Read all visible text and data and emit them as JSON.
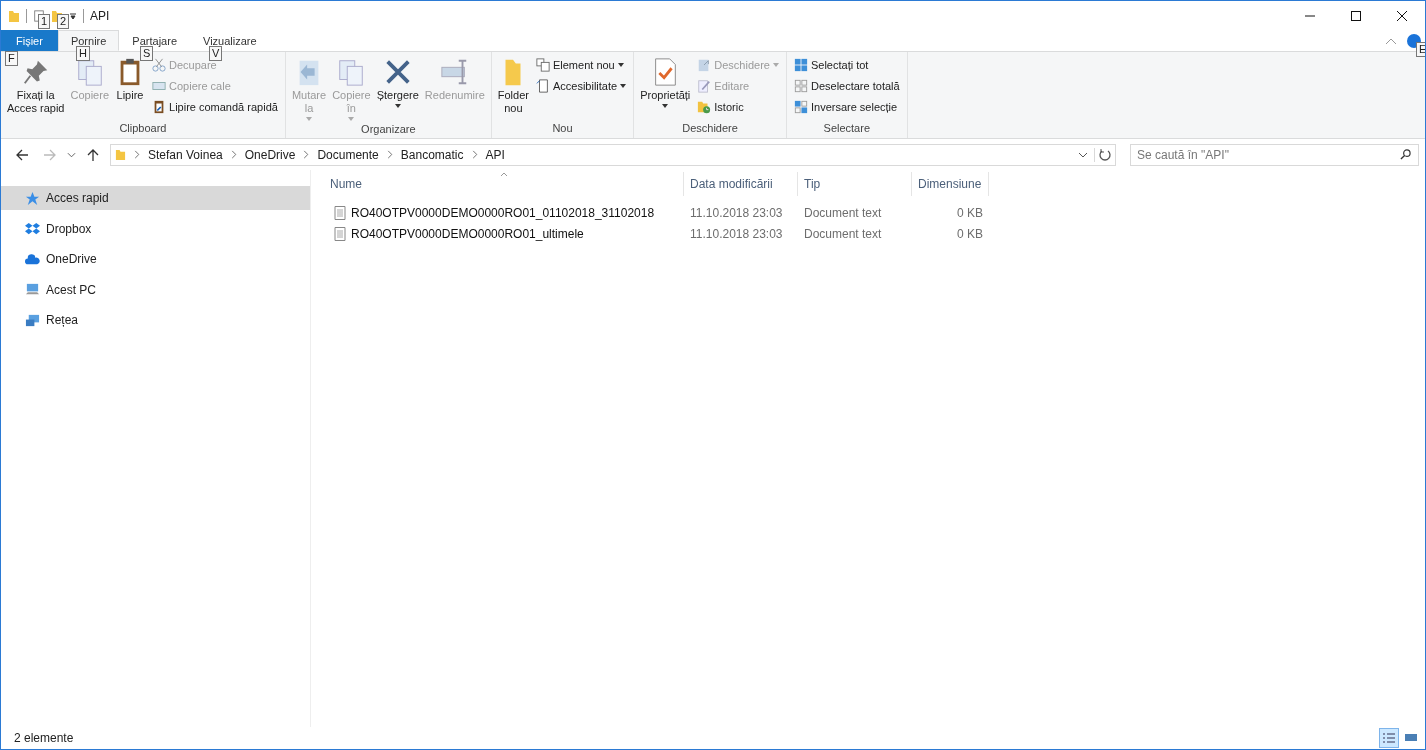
{
  "window": {
    "title": "API"
  },
  "keytips": [
    "1",
    "2",
    "F",
    "H",
    "S",
    "V",
    "E"
  ],
  "ribbon": {
    "tabs": [
      {
        "label": "Fișier",
        "kind": "file",
        "selected": false
      },
      {
        "label": "Pornire",
        "kind": "tab",
        "selected": true
      },
      {
        "label": "Partajare",
        "kind": "tab",
        "selected": false
      },
      {
        "label": "Vizualizare",
        "kind": "tab",
        "selected": false
      }
    ],
    "groups": [
      {
        "name": "Clipboard",
        "items": [
          {
            "kind": "large",
            "label": "Fixați la\nAcces rapid",
            "disabled": false,
            "dropdown": false
          },
          {
            "kind": "large",
            "label": "Copiere",
            "disabled": true,
            "dropdown": false
          },
          {
            "kind": "large",
            "label": "Lipire",
            "disabled": false,
            "dropdown": false
          },
          {
            "kind": "small",
            "label": "Decupare",
            "disabled": true,
            "dropdown": false
          },
          {
            "kind": "small",
            "label": "Copiere cale",
            "disabled": true,
            "dropdown": false
          },
          {
            "kind": "small",
            "label": "Lipire comandă rapidă",
            "disabled": false,
            "dropdown": false
          }
        ]
      },
      {
        "name": "Organizare",
        "items": [
          {
            "kind": "large",
            "label": "Mutare\nla",
            "disabled": true,
            "dropdown": true
          },
          {
            "kind": "large",
            "label": "Copiere\nîn",
            "disabled": true,
            "dropdown": true
          },
          {
            "kind": "large",
            "label": "Ștergere",
            "disabled": false,
            "dropdown": true
          },
          {
            "kind": "large",
            "label": "Redenumire",
            "disabled": true,
            "dropdown": false
          }
        ]
      },
      {
        "name": "Nou",
        "items": [
          {
            "kind": "large",
            "label": "Folder\nnou",
            "disabled": false,
            "dropdown": false
          },
          {
            "kind": "small",
            "label": "Element nou",
            "disabled": false,
            "dropdown": true
          },
          {
            "kind": "small",
            "label": "Accesibilitate",
            "disabled": false,
            "dropdown": true
          }
        ]
      },
      {
        "name": "Deschidere",
        "items": [
          {
            "kind": "large",
            "label": "Proprietăți",
            "disabled": false,
            "dropdown": true
          },
          {
            "kind": "small",
            "label": "Deschidere",
            "disabled": true,
            "dropdown": true
          },
          {
            "kind": "small",
            "label": "Editare",
            "disabled": true,
            "dropdown": false
          },
          {
            "kind": "small",
            "label": "Istoric",
            "disabled": false,
            "dropdown": false
          }
        ]
      },
      {
        "name": "Selectare",
        "items": [
          {
            "kind": "small",
            "label": "Selectați tot",
            "disabled": false,
            "dropdown": false
          },
          {
            "kind": "small",
            "label": "Deselectare totală",
            "disabled": false,
            "dropdown": false
          },
          {
            "kind": "small",
            "label": "Inversare selecție",
            "disabled": false,
            "dropdown": false
          }
        ]
      }
    ]
  },
  "address": {
    "crumbs": [
      "Stefan Voinea",
      "OneDrive",
      "Documente",
      "Bancomatic",
      "API"
    ]
  },
  "search": {
    "placeholder": "Se caută în \"API\""
  },
  "sidebar": {
    "items": [
      {
        "label": "Acces rapid",
        "selected": true
      },
      {
        "label": "Dropbox",
        "selected": false
      },
      {
        "label": "OneDrive",
        "selected": false
      },
      {
        "label": "Acest PC",
        "selected": false
      },
      {
        "label": "Rețea",
        "selected": false
      }
    ]
  },
  "table": {
    "columns": [
      "Nume",
      "Data modificării",
      "Tip",
      "Dimensiune"
    ],
    "rows": [
      [
        "RO40OTPV0000DEMO0000RO01_01102018_31102018",
        "11.10.2018 23:03",
        "Document text",
        "0 KB"
      ],
      [
        "RO40OTPV0000DEMO0000RO01_ultimele",
        "11.10.2018 23:03",
        "Document text",
        "0 KB"
      ]
    ]
  },
  "status_bar": {
    "text": "2 elemente",
    "views": [
      {
        "kind": "details",
        "selected": true
      },
      {
        "kind": "large-icons",
        "selected": false
      }
    ]
  }
}
